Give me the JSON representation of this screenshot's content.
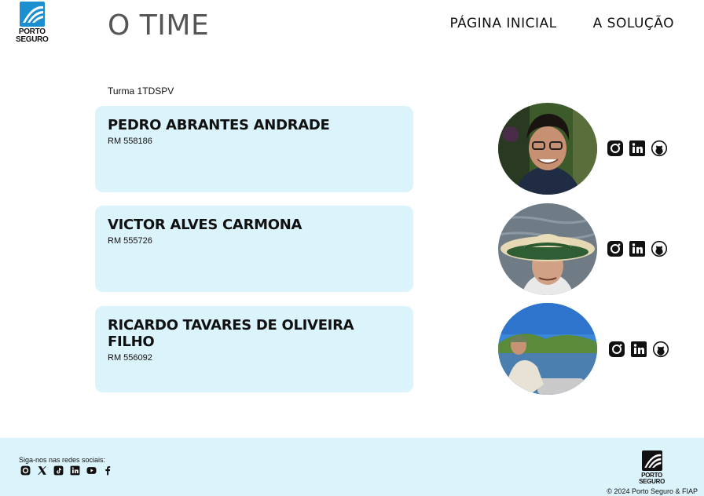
{
  "brand": {
    "line1": "PORTO",
    "line2": "SEGURO",
    "color": "#1c8fd1"
  },
  "header": {
    "title": "O TIME"
  },
  "nav": {
    "items": [
      {
        "label": "PÁGINA INICIAL"
      },
      {
        "label": "A SOLUÇÃO"
      }
    ]
  },
  "team": {
    "class_label": "Turma 1TDSPV",
    "members": [
      {
        "name": "PEDRO ABRANTES ANDRADE",
        "rm": "RM 558186"
      },
      {
        "name": "VICTOR ALVES CARMONA",
        "rm": "RM 555726"
      },
      {
        "name": "RICARDO TAVARES DE OLIVEIRA FILHO",
        "rm": "RM 556092"
      }
    ],
    "social_icons": [
      "instagram-icon",
      "linkedin-icon",
      "github-icon"
    ]
  },
  "footer": {
    "follow_label": "Siga-nos nas redes sociais:",
    "icons": [
      "instagram-icon",
      "x-icon",
      "tiktok-icon",
      "linkedin-icon",
      "youtube-icon",
      "facebook-icon"
    ],
    "copyright": "© 2024 Porto Seguro & FIAP",
    "background": "#dbf3fb"
  }
}
